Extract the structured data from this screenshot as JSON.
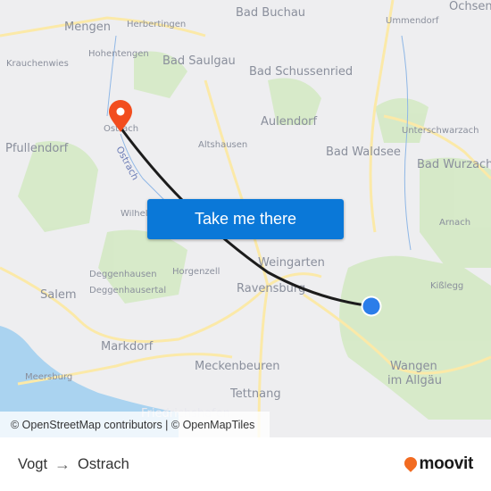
{
  "map": {
    "labels": [
      {
        "text": "Mengen",
        "size": "big"
      },
      {
        "text": "Herbertingen",
        "size": "small"
      },
      {
        "text": "Bad Buchau",
        "size": "big"
      },
      {
        "text": "Ummendorf",
        "size": "small"
      },
      {
        "text": "Ochsen",
        "size": "big"
      },
      {
        "text": "Hohentengen",
        "size": "small"
      },
      {
        "text": "Krauchenwies",
        "size": "small"
      },
      {
        "text": "Bad Saulgau",
        "size": "big"
      },
      {
        "text": "Bad Schussenried",
        "size": "big"
      },
      {
        "text": "Aulendorf",
        "size": "big"
      },
      {
        "text": "Unterschwarzach",
        "size": "small"
      },
      {
        "text": "Ostrach",
        "size": "small"
      },
      {
        "text": "Pfullendorf",
        "size": "big"
      },
      {
        "text": "Altshausen",
        "size": "small"
      },
      {
        "text": "Bad Waldsee",
        "size": "big"
      },
      {
        "text": "Bad Wurzach",
        "size": "big"
      },
      {
        "text": "Wilhelmsdorf",
        "size": "small"
      },
      {
        "text": "Arnach",
        "size": "small"
      },
      {
        "text": "Weingarten",
        "size": "big"
      },
      {
        "text": "Deggenhausen",
        "size": "small"
      },
      {
        "text": "Horgenzell",
        "size": "small"
      },
      {
        "text": "Deggenhausertal",
        "size": "small"
      },
      {
        "text": "Kißlegg",
        "size": "small"
      },
      {
        "text": "Salem",
        "size": "big"
      },
      {
        "text": "Ravensburg",
        "size": "big"
      },
      {
        "text": "Markdorf",
        "size": "big"
      },
      {
        "text": "Meckenbeuren",
        "size": "big"
      },
      {
        "text": "Wangen",
        "size": "big"
      },
      {
        "text": "im Allgäu",
        "size": "big"
      },
      {
        "text": "Meersburg",
        "size": "small"
      },
      {
        "text": "Tettnang",
        "size": "big"
      },
      {
        "text": "Friedrichshafen",
        "size": "big"
      }
    ],
    "river_label": "Ostrach",
    "origin_marker": {
      "name": "Vogt",
      "color": "#2b7de9"
    },
    "destination_marker": {
      "name": "Ostrach",
      "color": "#f24d1e"
    },
    "route_color": "#1c1c1c"
  },
  "cta": {
    "label": "Take me there",
    "color": "#0a78d8"
  },
  "attribution": "© OpenStreetMap contributors | © OpenMapTiles",
  "footer": {
    "from": "Vogt",
    "to": "Ostrach",
    "arrow": "→",
    "brand": "moovit",
    "brand_color": "#f26b21"
  }
}
